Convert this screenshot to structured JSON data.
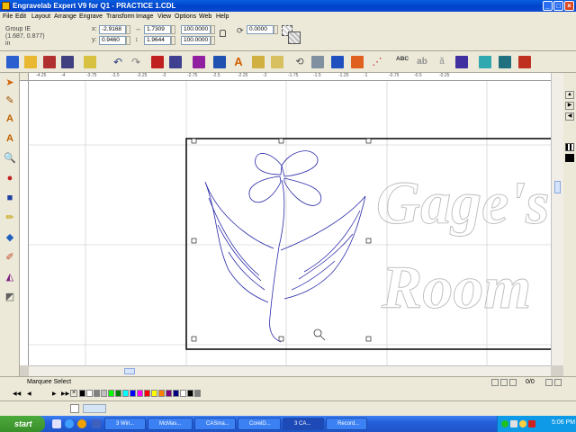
{
  "window": {
    "title": "Engravelab Expert V9 for Q1 - PRACTICE 1.CDL"
  },
  "menu": [
    "File",
    "Edit",
    "Layout",
    "Arrange",
    "Engrave",
    "Transform",
    "Image",
    "View",
    "Options",
    "Web",
    "Help"
  ],
  "propbar": {
    "object_name": "Group IE",
    "position": "(1.687, 0.877)",
    "units": "in",
    "x": "-2.9168",
    "y": "0.9460",
    "width": "1.7309",
    "height": "1.9644",
    "scale_x": "100.0000",
    "scale_y": "100.0000",
    "rotation": "0.0000"
  },
  "toolbar": {
    "abc_label": "ABC"
  },
  "ruler_top": [
    "-4.25",
    "-4",
    "-3.75",
    "-3.5",
    "-3.25",
    "-3",
    "-2.75",
    "-2.5",
    "-2.25",
    "-2",
    "-1.75",
    "-1.5",
    "-1.25",
    "-1",
    "-0.75",
    "-0.5",
    "-0.25"
  ],
  "canvas": {
    "word1": "Gage's",
    "word2": "Room"
  },
  "status": {
    "mode": "Marquee Select",
    "page": "0/0"
  },
  "palette": [
    "#000000",
    "#ffffff",
    "#808080",
    "#c0c0c0",
    "#00ff00",
    "#008000",
    "#00ffff",
    "#0000ff",
    "#ff00ff",
    "#ff0000",
    "#ffff00",
    "#ff8000",
    "#800080",
    "#000080",
    "#ffffff",
    "#000000",
    "#808080"
  ],
  "taskbar": {
    "start": "start",
    "tasks": [
      "3 Win...",
      "McMas...",
      "CASma...",
      "CorelD...",
      "3 CA...",
      "Record..."
    ],
    "clock": "5:06 PM"
  }
}
